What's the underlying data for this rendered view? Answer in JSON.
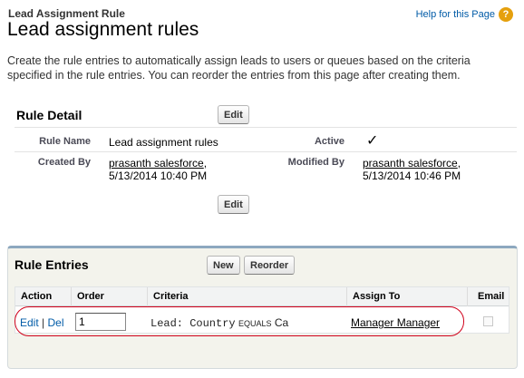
{
  "header": {
    "eyebrow": "Lead Assignment Rule",
    "title": "Lead assignment rules",
    "help_link": "Help for this Page",
    "help_icon": "?"
  },
  "intro": "Create the rule entries to automatically assign leads to users or queues based on the criteria specified in the rule entries. You can reorder the entries from this page after creating them.",
  "rule_detail": {
    "section_title": "Rule Detail",
    "edit_label": "Edit",
    "fields": {
      "rule_name_label": "Rule Name",
      "rule_name_value": "Lead assignment rules",
      "active_label": "Active",
      "active_checked": true,
      "active_mark": "✓",
      "created_by_label": "Created By",
      "created_by_user": "prasanth salesforce",
      "created_by_sep": ",",
      "created_by_date": "5/13/2014 10:40 PM",
      "modified_by_label": "Modified By",
      "modified_by_user": "prasanth salesforce",
      "modified_by_sep": ",",
      "modified_by_date": "5/13/2014 10:46 PM"
    }
  },
  "rule_entries": {
    "section_title": "Rule Entries",
    "new_label": "New",
    "reorder_label": "Reorder",
    "columns": [
      "Action",
      "Order",
      "Criteria",
      "Assign To",
      "Email"
    ],
    "rows": [
      {
        "action_edit": "Edit",
        "action_sep": "|",
        "action_del": "Del",
        "order": "1",
        "criteria_field": "Lead: Country",
        "criteria_op": "EQUALS",
        "criteria_value": "Ca",
        "assign_to": "Manager Manager",
        "email_checked": false
      }
    ]
  },
  "colors": {
    "link": "#015ba7",
    "highlight": "#d0021b",
    "panel_top_border": "#8da8bf",
    "help_icon": "#e5a00d"
  }
}
